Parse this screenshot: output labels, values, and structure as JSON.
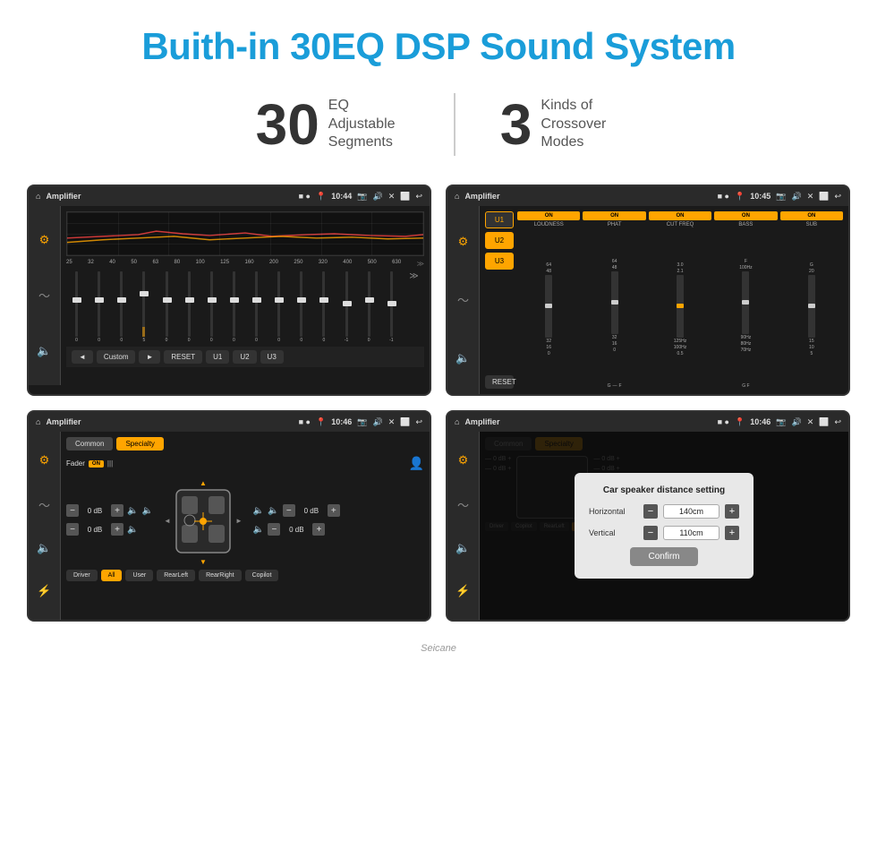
{
  "page": {
    "title": "Buith-in 30EQ DSP Sound System",
    "stats": [
      {
        "number": "30",
        "label": "EQ Adjustable\nSegments"
      },
      {
        "number": "3",
        "label": "Kinds of\nCrossover Modes"
      }
    ]
  },
  "screens": [
    {
      "id": "screen-eq",
      "topbar": {
        "home": "⌂",
        "title": "Amplifier",
        "time": "10:44",
        "icons": "📷 🔊 ✕ ⬜ ↩"
      },
      "eq_freqs": [
        "25",
        "32",
        "40",
        "50",
        "63",
        "80",
        "100",
        "125",
        "160",
        "200",
        "250",
        "320",
        "400",
        "500",
        "630"
      ],
      "eq_values": [
        0,
        0,
        0,
        5,
        0,
        0,
        0,
        0,
        0,
        0,
        0,
        0,
        -1,
        0,
        -1
      ],
      "bottom_btns": [
        "◄",
        "Custom",
        "►",
        "RESET",
        "U1",
        "U2",
        "U3"
      ]
    },
    {
      "id": "screen-crossover",
      "topbar": {
        "home": "⌂",
        "title": "Amplifier",
        "time": "10:45",
        "icons": "📷 🔊 ✕ ⬜ ↩"
      },
      "presets": [
        "U1",
        "U2",
        "U3"
      ],
      "channels": [
        "LOUDNESS",
        "PHAT",
        "CUT FREQ",
        "BASS",
        "SUB"
      ],
      "reset_label": "RESET"
    },
    {
      "id": "screen-specialty",
      "topbar": {
        "home": "⌂",
        "title": "Amplifier",
        "time": "10:46",
        "icons": "📷 🔊 ✕ ⬜ ↩"
      },
      "top_btns": [
        "Common",
        "Specialty"
      ],
      "fader_label": "Fader",
      "fader_state": "ON",
      "vol_rows": [
        {
          "minus": "—",
          "val": "0 dB",
          "plus": "+",
          "side": "left"
        },
        {
          "minus": "—",
          "val": "0 dB",
          "plus": "+",
          "side": "left"
        },
        {
          "minus": "—",
          "val": "0 dB",
          "plus": "+",
          "side": "right"
        },
        {
          "minus": "—",
          "val": "0 dB",
          "plus": "+",
          "side": "right"
        }
      ],
      "zone_btns": [
        "Driver",
        "Copilot",
        "RearLeft",
        "All",
        "User",
        "RearRight"
      ]
    },
    {
      "id": "screen-dialog",
      "topbar": {
        "home": "⌂",
        "title": "Amplifier",
        "time": "10:46",
        "icons": "📷 🔊 ✕ ⬜ ↩"
      },
      "top_btns": [
        "Common",
        "Specialty"
      ],
      "dialog": {
        "title": "Car speaker distance setting",
        "rows": [
          {
            "label": "Horizontal",
            "value": "140cm"
          },
          {
            "label": "Vertical",
            "value": "110cm"
          }
        ],
        "confirm_btn": "Confirm"
      },
      "zone_btns_bottom": [
        "Driver",
        "Copilot",
        "RearLeft",
        "All",
        "User",
        "RearRight"
      ]
    }
  ],
  "watermark": "Seicane"
}
